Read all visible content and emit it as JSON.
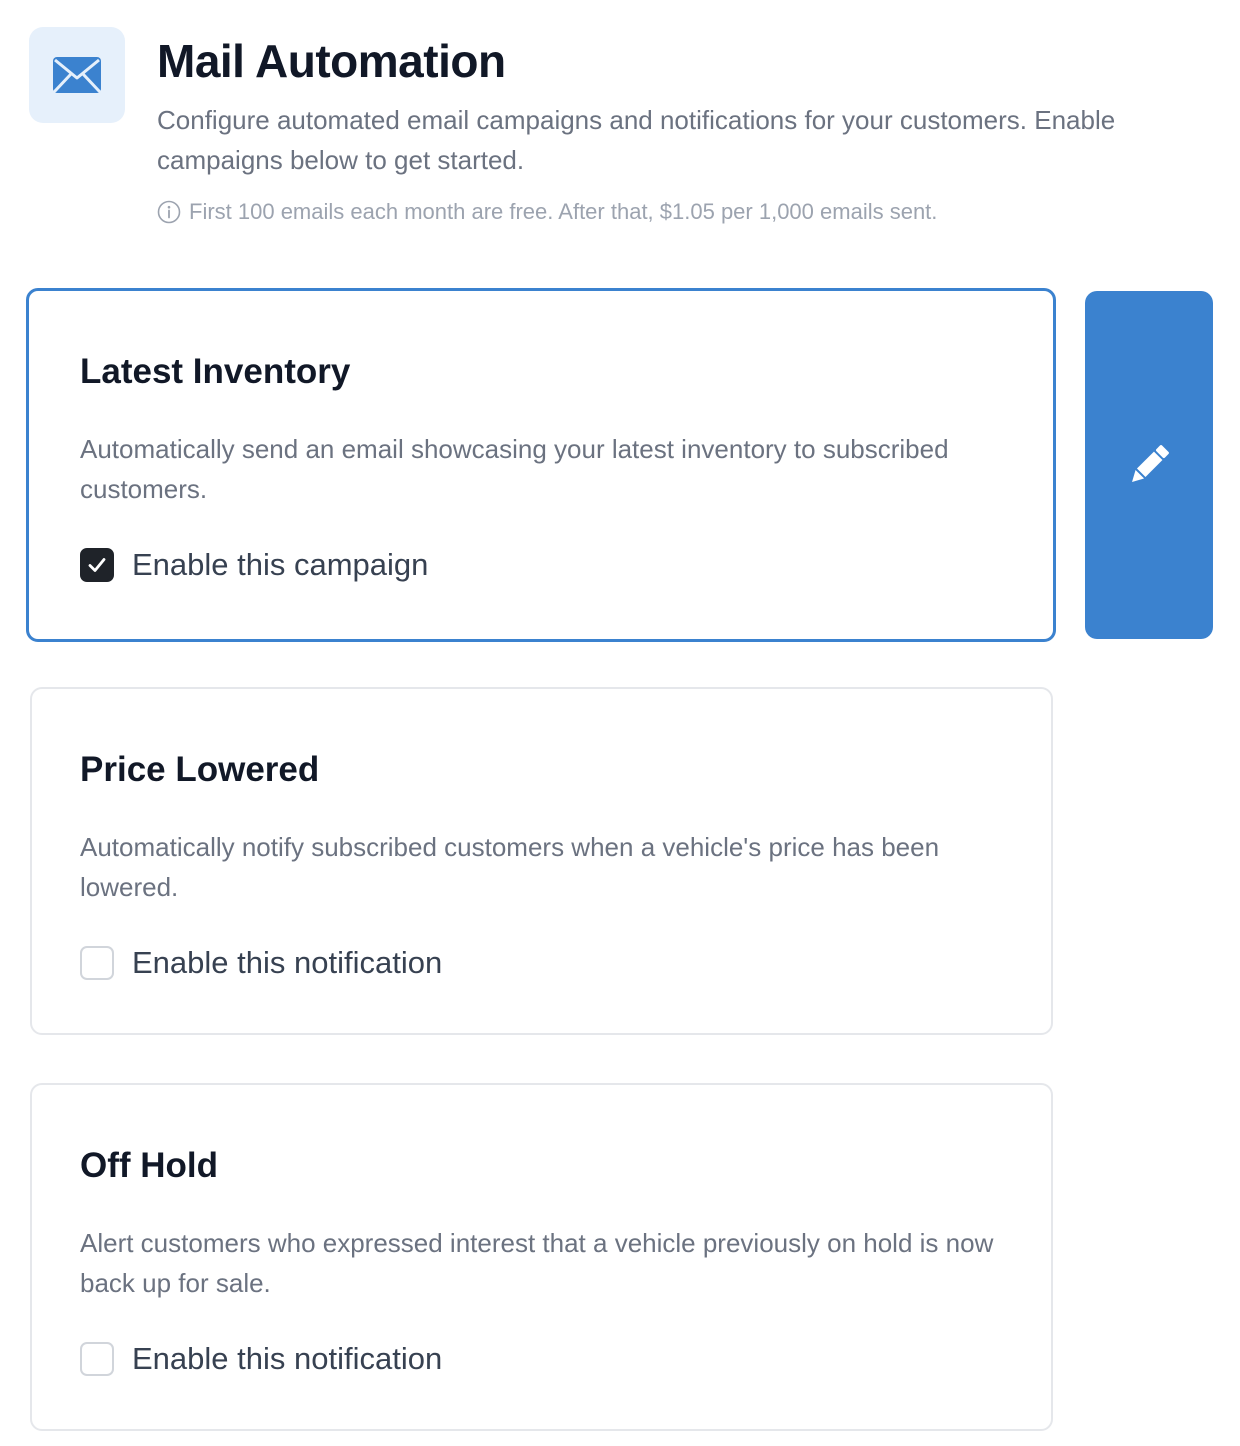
{
  "header": {
    "icon": "envelope-icon",
    "title": "Mail Automation",
    "description": "Configure automated email campaigns and notifications for your customers. Enable campaigns below to get started.",
    "pricing_icon": "info-icon",
    "pricing_note": "First 100 emails each month are free. After that, $1.05 per 1,000 emails sent."
  },
  "campaigns": [
    {
      "title": "Latest Inventory",
      "description": "Automatically send an email showcasing your latest inventory to subscribed customers.",
      "checkbox_label": "Enable this campaign",
      "checked": true,
      "active": true
    },
    {
      "title": "Price Lowered",
      "description": "Automatically notify subscribed customers when a vehicle's price has been lowered.",
      "checkbox_label": "Enable this notification",
      "checked": false,
      "active": false
    },
    {
      "title": "Off Hold",
      "description": "Alert customers who expressed interest that a vehicle previously on hold is now back up for sale.",
      "checkbox_label": "Enable this notification",
      "checked": false,
      "active": false
    }
  ],
  "edit_button": {
    "icon": "pencil-icon"
  },
  "colors": {
    "accent": "#3b82cf",
    "icon_tile_bg": "#e6f0fb",
    "title_text": "#111827",
    "body_text": "#6b7280",
    "muted_text": "#9ca3af",
    "checkbox_checked": "#1f2329"
  }
}
